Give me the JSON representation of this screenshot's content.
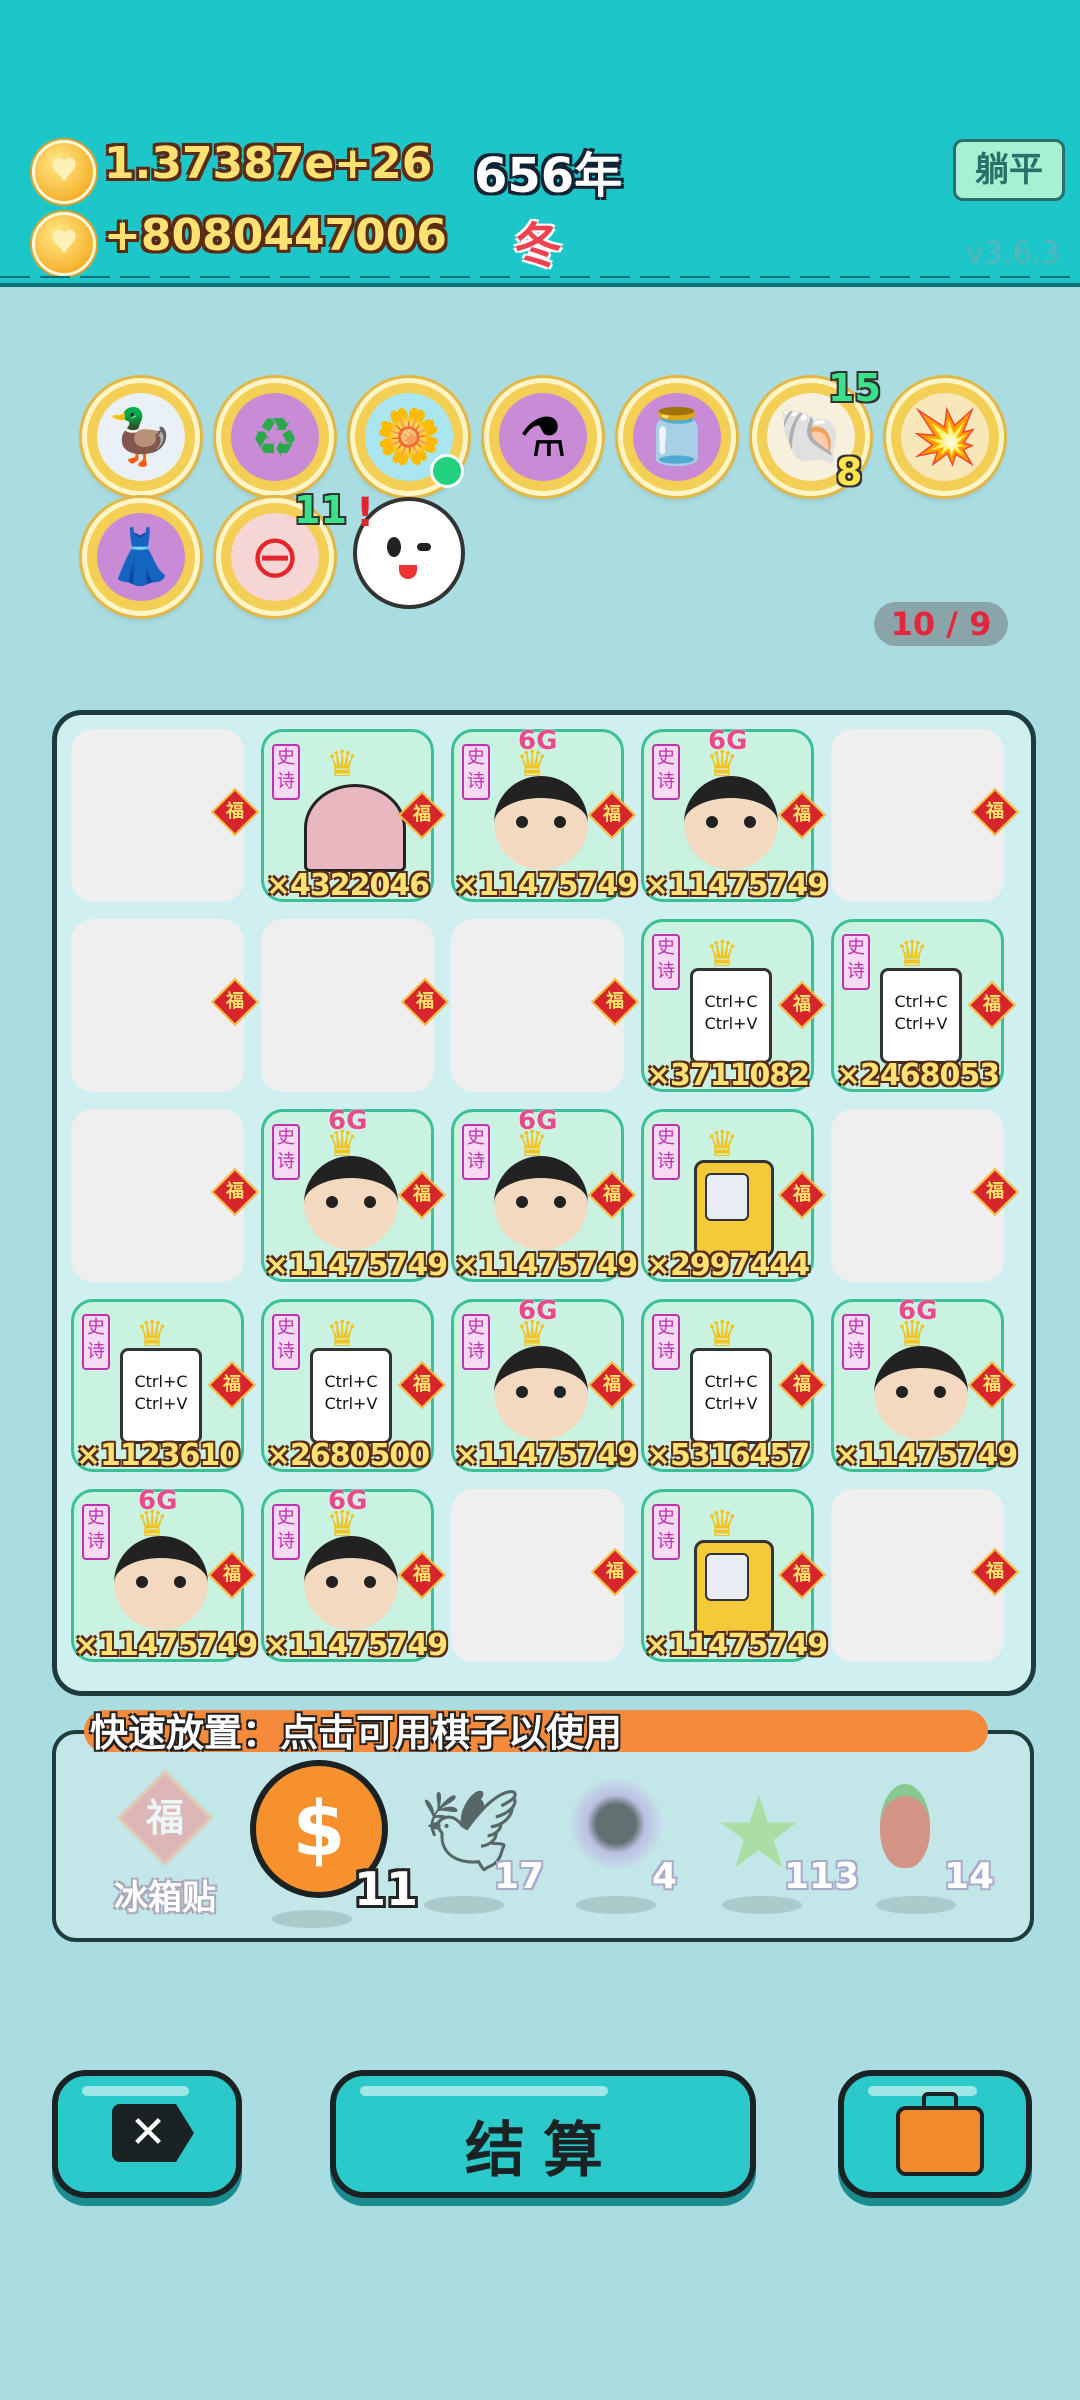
{
  "header": {
    "money_total": "1.37387e+26",
    "money_rate": "+8080447006",
    "year": "656年",
    "season": "冬",
    "lie_flat_button": "躺平",
    "version": "v3.6.3"
  },
  "items": [
    {
      "icon": "duck-pot-icon"
    },
    {
      "icon": "recycle-icon"
    },
    {
      "icon": "flower-pot-icon"
    },
    {
      "icon": "mixer-icon"
    },
    {
      "icon": "jar-icon"
    },
    {
      "icon": "shell-icon",
      "count_top": "15",
      "count_bottom": "8"
    },
    {
      "icon": "explosion-icon"
    },
    {
      "icon": "skirt-icon"
    },
    {
      "icon": "minus-icon",
      "count_top": "11"
    },
    {
      "icon": "ghost-icon",
      "alert": "!"
    }
  ],
  "board_counter": "10 / 9",
  "board": {
    "rows": [
      [
        {
          "type": "empty"
        },
        {
          "type": "tent",
          "tag": "史诗",
          "mult": "×4322046"
        },
        {
          "type": "face",
          "tag": "史诗",
          "mult": "×11475749"
        },
        {
          "type": "face",
          "tag": "史诗",
          "mult": "×11475749"
        },
        {
          "type": "empty"
        }
      ],
      [
        {
          "type": "empty"
        },
        {
          "type": "empty"
        },
        {
          "type": "empty"
        },
        {
          "type": "card",
          "tag": "史诗",
          "mult": "×3711082"
        },
        {
          "type": "card",
          "tag": "史诗",
          "mult": "×2468053"
        }
      ],
      [
        {
          "type": "empty"
        },
        {
          "type": "face",
          "tag": "史诗",
          "mult": "×11475749"
        },
        {
          "type": "face",
          "tag": "史诗",
          "mult": "×11475749"
        },
        {
          "type": "vend",
          "tag": "史诗",
          "mult": "×2997444"
        },
        {
          "type": "empty"
        }
      ],
      [
        {
          "type": "card",
          "tag": "史诗",
          "mult": "×1123610"
        },
        {
          "type": "card",
          "tag": "史诗",
          "mult": "×2680500"
        },
        {
          "type": "face",
          "tag": "史诗",
          "mult": "×11475749"
        },
        {
          "type": "card",
          "tag": "史诗",
          "mult": "×5316457"
        },
        {
          "type": "face",
          "tag": "史诗",
          "mult": "×11475749"
        }
      ],
      [
        {
          "type": "face",
          "tag": "史诗",
          "mult": "×11475749"
        },
        {
          "type": "face",
          "tag": "史诗",
          "mult": "×11475749"
        },
        {
          "type": "empty"
        },
        {
          "type": "vend",
          "tag": "史诗",
          "mult": "×11475749"
        },
        {
          "type": "empty"
        }
      ]
    ],
    "fu_char": "福",
    "card_text": [
      "Ctrl+C",
      "Ctrl+V"
    ],
    "sixg": "6G"
  },
  "quick_place": {
    "label": "快速放置：点击可用棋子以使用",
    "items": [
      {
        "icon": "fridge-magnet-icon",
        "label": "冰箱贴",
        "glyph": "福"
      },
      {
        "icon": "dollar-coin-icon",
        "count": "11",
        "glyph": "$"
      },
      {
        "icon": "duck-icon",
        "count": "17"
      },
      {
        "icon": "black-hole-icon",
        "count": "4"
      },
      {
        "icon": "star-icon",
        "count": "113",
        "glyph": "★"
      },
      {
        "icon": "chili-icon",
        "count": "14"
      }
    ]
  },
  "bottom": {
    "close_glyph": "✕",
    "settle_label": "结算"
  }
}
